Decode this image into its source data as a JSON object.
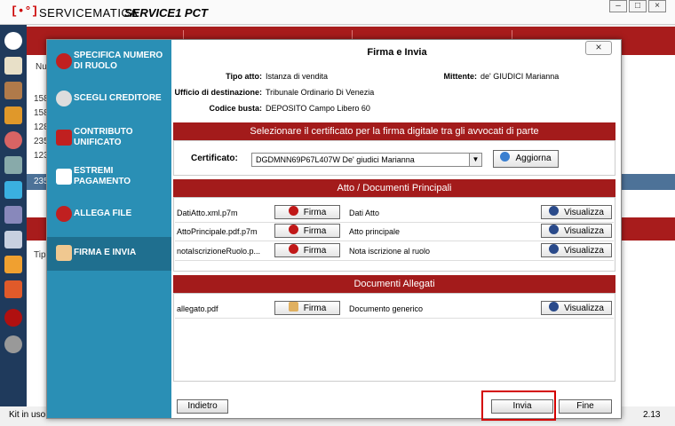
{
  "app": {
    "logo": "[•°]",
    "brand": "SERVICEMATICA",
    "product": "SERVICE1 PCT",
    "version": "2.13",
    "status_left": "Kit in uso"
  },
  "background": {
    "column_label": "Nu",
    "row_labels": [
      "158",
      "158",
      "128",
      "235",
      "123"
    ],
    "selected_row": "235",
    "tip_label": "Tip"
  },
  "dialog": {
    "title": "Firma e Invia",
    "close_label": "×",
    "nav": [
      {
        "label": "SPECIFICA NUMERO DI RUOLO"
      },
      {
        "label": "SCEGLI CREDITORE"
      },
      {
        "label": "CONTRIBUTO UNIFICATO"
      },
      {
        "label": "ESTREMI PAGAMENTO"
      },
      {
        "label": "ALLEGA FILE"
      },
      {
        "label": "FIRMA E INVIA"
      }
    ],
    "info": {
      "tipo_atto_label": "Tipo atto:",
      "tipo_atto": "Istanza di vendita",
      "mittente_label": "Mittente:",
      "mittente": "de' GIUDICI Marianna",
      "ufficio_label": "Ufficio di destinazione:",
      "ufficio": "Tribunale Ordinario Di Venezia",
      "codice_label": "Codice busta:",
      "codice": "DEPOSITO Campo Libero 60"
    },
    "cert_section": {
      "title": "Selezionare il certificato per la firma digitale tra gli avvocati di parte",
      "label": "Certificato:",
      "value": "DGDMNN69P67L407W  De' giudici Marianna",
      "refresh_label": "Aggiorna"
    },
    "principal_section": {
      "title": "Atto / Documenti Principali",
      "rows": [
        {
          "file": "DatiAtto.xml.p7m",
          "sign": "Firma",
          "desc": "Dati Atto",
          "view": "Visualizza"
        },
        {
          "file": "AttoPrincipale.pdf.p7m",
          "sign": "Firma",
          "desc": "Atto principale",
          "view": "Visualizza"
        },
        {
          "file": "notaIscrizioneRuolo.p...",
          "sign": "Firma",
          "desc": "Nota iscrizione al ruolo",
          "view": "Visualizza"
        }
      ]
    },
    "attachments_section": {
      "title": "Documenti Allegati",
      "rows": [
        {
          "file": "allegato.pdf",
          "sign": "Firma",
          "desc": "Documento generico",
          "view": "Visualizza"
        }
      ]
    },
    "buttons": {
      "back": "Indietro",
      "send": "Invia",
      "finish": "Fine"
    }
  },
  "colors": {
    "accent_red": "#a31b1b",
    "nav_blue": "#2a8fb5",
    "nav_active": "#1f6f8f",
    "highlight": "#d40000"
  }
}
